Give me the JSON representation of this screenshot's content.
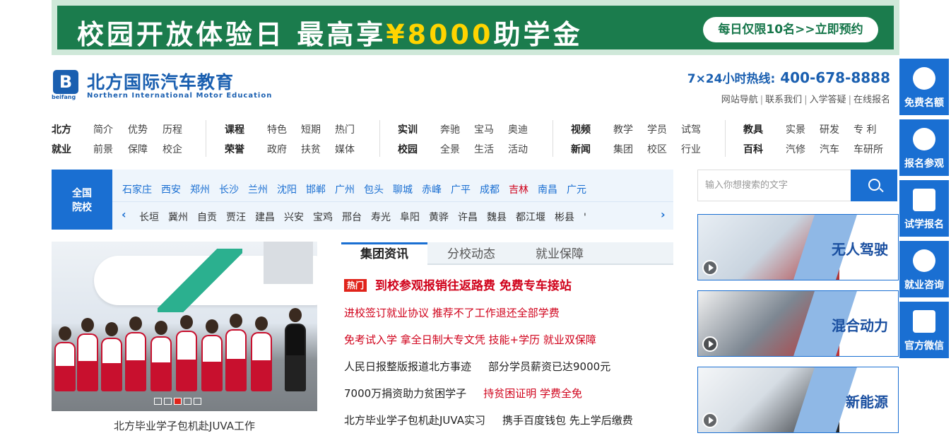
{
  "banner": {
    "text_part1": "校园开放体验日 最高享",
    "text_currency": "¥8000",
    "text_part2": "助学金",
    "cta": "每日仅限10名>>立即预约"
  },
  "logo": {
    "mark": "B",
    "mark_sub": "beifang",
    "name_cn": "北方国际汽车教育",
    "name_en": "Northern International Motor Education"
  },
  "hotline": {
    "label": "7×24小时热线:",
    "number": "400-678-8888"
  },
  "toplinks": [
    "网站导航",
    "联系我们",
    "入学答疑",
    "在线报名"
  ],
  "nav": [
    {
      "rows": [
        {
          "head": "北方",
          "items": [
            "简介",
            "优势",
            "历程"
          ]
        },
        {
          "head": "就业",
          "items": [
            "前景",
            "保障",
            "校企"
          ]
        }
      ]
    },
    {
      "rows": [
        {
          "head": "课程",
          "items": [
            "特色",
            "短期",
            "热门"
          ]
        },
        {
          "head": "荣誉",
          "items": [
            "政府",
            "扶贫",
            "媒体"
          ]
        }
      ]
    },
    {
      "rows": [
        {
          "head": "实训",
          "items": [
            "奔驰",
            "宝马",
            "奥迪"
          ]
        },
        {
          "head": "校园",
          "items": [
            "全景",
            "生活",
            "活动"
          ]
        }
      ]
    },
    {
      "rows": [
        {
          "head": "视频",
          "items": [
            "教学",
            "学员",
            "试驾"
          ]
        },
        {
          "head": "新闻",
          "items": [
            "集团",
            "校区",
            "行业"
          ]
        }
      ]
    },
    {
      "rows": [
        {
          "head": "教具",
          "items": [
            "实景",
            "研发",
            "专 利"
          ]
        },
        {
          "head": "百科",
          "items": [
            "汽修",
            "汽车",
            "车研所"
          ]
        }
      ]
    }
  ],
  "cities": {
    "tag_line1": "全国",
    "tag_line2": "院校",
    "row1": [
      "石家庄",
      "西安",
      "郑州",
      "长沙",
      "兰州",
      "沈阳",
      "邯郸",
      "广州",
      "包头",
      "聊城",
      "赤峰",
      "广平",
      "成都",
      "吉林",
      "南昌",
      "广元"
    ],
    "row1_highlight": "吉林",
    "row2": [
      "长垣",
      "冀州",
      "自贡",
      "贾汪",
      "建昌",
      "兴安",
      "宝鸡",
      "邢台",
      "寿光",
      "阜阳",
      "黄骅",
      "许昌",
      "魏县",
      "都江堰",
      "彬县",
      "'"
    ],
    "arrow_left": "‹",
    "arrow_right": "›"
  },
  "search": {
    "placeholder": "输入你想搜索的文字"
  },
  "photo": {
    "caption": "北方毕业学子包机赴JUVA工作",
    "slides": 5,
    "active_slide": 3
  },
  "news": {
    "tabs": [
      "集团资讯",
      "分校动态",
      "就业保障"
    ],
    "active_tab": 0,
    "hot_badge": "热门",
    "headline": "到校参观报销往返路费 免费专车接站",
    "items": [
      {
        "text": "进校签订就业协议 推荐不了工作退还全部学费",
        "tail": "",
        "color": "red"
      },
      {
        "text": "免考试入学 拿全日制大专文凭 技能+学历 就业双保障",
        "tail": "",
        "color": "red"
      },
      {
        "text": "人民日报整版报道北方事迹",
        "tail": "部分学员薪资已达9000元",
        "color": "black",
        "tail_color": "black"
      },
      {
        "text": "7000万捐资助力贫困学子",
        "tail": "持贫困证明 学费全免",
        "color": "black",
        "tail_color": "red"
      },
      {
        "text": "北方毕业学子包机赴JUVA实习",
        "tail": "携手百度钱包 先上学后缴费",
        "color": "black",
        "tail_color": "black"
      }
    ]
  },
  "cards": [
    {
      "label": "无人驾驶"
    },
    {
      "label": "混合动力"
    },
    {
      "label": "新能源"
    }
  ],
  "sidebar": [
    {
      "label": "免费名额",
      "icon": "user-icon"
    },
    {
      "label": "报名参观",
      "icon": "chat-icon"
    },
    {
      "label": "试学报名",
      "icon": "edit-icon"
    },
    {
      "label": "就业咨询",
      "icon": "phone-icon"
    },
    {
      "label": "官方微信",
      "icon": "qrcode-icon"
    }
  ],
  "colors": {
    "brand_blue": "#1a6fd2",
    "banner_green": "#1b7c4d",
    "accent_red": "#d0021b"
  }
}
